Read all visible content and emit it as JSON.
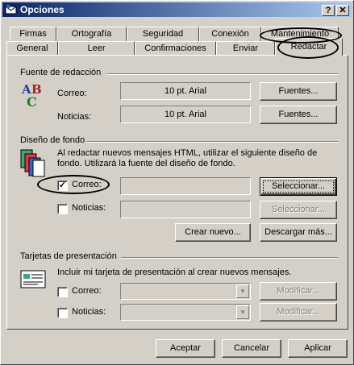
{
  "window": {
    "title": "Opciones",
    "help_glyph": "?",
    "close_glyph": "✕"
  },
  "tabs_row1": [
    "Firmas",
    "Ortografía",
    "Seguridad",
    "Conexión",
    "Mantenimiento"
  ],
  "tabs_row2": [
    "General",
    "Leer",
    "Confirmaciones",
    "Enviar",
    "Redactar"
  ],
  "font_section": {
    "title": "Fuente de redacción",
    "mail_label": "Correo:",
    "news_label": "Noticias:",
    "mail_font": "10 pt. Arial",
    "news_font": "10 pt. Arial",
    "fonts_button_1": "Fuentes...",
    "fonts_button_2": "Fuentes...",
    "icon_letters": "ABC"
  },
  "stationery_section": {
    "title": "Diseño de fondo",
    "description": "Al redactar nuevos mensajes HTML, utilizar el siguiente diseño de fondo. Utilizará la fuente del diseño de fondo.",
    "mail_label": "Correo:",
    "mail_checked": true,
    "news_label": "Noticias:",
    "news_checked": false,
    "mail_value": "",
    "news_value": "",
    "select_button_1": "Seleccionar...",
    "select_button_2": "Seleccionar...",
    "create_button": "Crear nuevo...",
    "download_button": "Descargar más..."
  },
  "business_card_section": {
    "title": "Tarjetas de presentación",
    "description": "Incluir mi tarjeta de presentación al crear nuevos mensajes.",
    "mail_label": "Correo:",
    "mail_checked": false,
    "news_label": "Noticias:",
    "news_checked": false,
    "mail_value": "",
    "news_value": "",
    "modify_button_1": "Modificar...",
    "modify_button_2": "Modificar..."
  },
  "footer": {
    "accept": "Aceptar",
    "cancel": "Cancelar",
    "apply": "Aplicar"
  },
  "colors": {
    "face": "#d4d0c8",
    "title_start": "#0a246a",
    "title_end": "#a6caf0",
    "disabled_text": "#808080"
  }
}
